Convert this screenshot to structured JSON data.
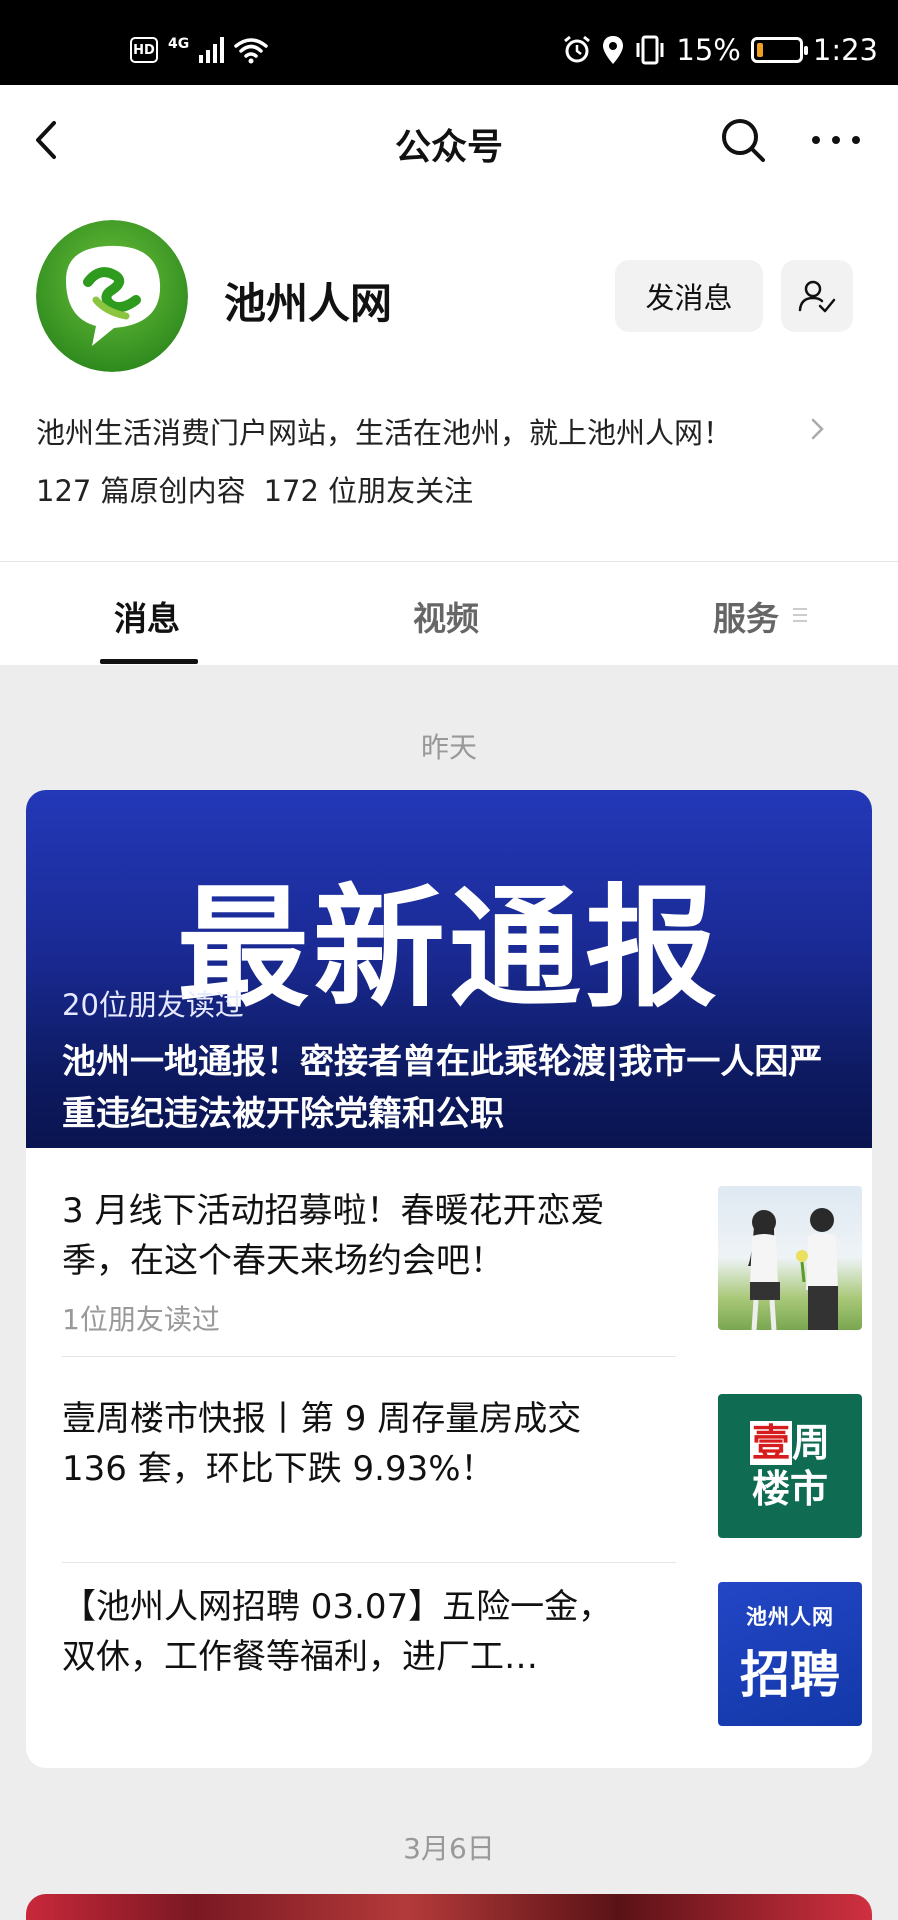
{
  "status_bar": {
    "hd": "HD",
    "network": "4G",
    "battery_percent": "15%",
    "time": "1:23",
    "battery_level": 0.15
  },
  "nav": {
    "title": "公众号",
    "icons": [
      "back-icon",
      "search-icon",
      "more-icon"
    ]
  },
  "account": {
    "name": "池州人网",
    "send_message_label": "发消息",
    "description": "池州生活消费门户网站，生活在池州，就上池州人网！",
    "original_count": "127 篇原创内容",
    "followers": "172 位朋友关注"
  },
  "tabs": [
    {
      "label": "消息",
      "active": true
    },
    {
      "label": "视频",
      "active": false
    },
    {
      "label": "服务",
      "active": false
    }
  ],
  "feed": {
    "date_1": "昨天",
    "hero": {
      "image_text": "最新通报",
      "reads": "20位朋友读过",
      "headline": "池州一地通报！密接者曾在此乘轮渡|我市一人因严重违纪违法被开除党籍和公职"
    },
    "items": [
      {
        "title": "3 月线下活动招募啦！春暖花开恋爱季，在这个春天来场约会吧！",
        "reads": "1位朋友读过",
        "thumb": "couple-photo"
      },
      {
        "title": "壹周楼市快报丨第 9 周存量房成交 136 套，环比下跌 9.93%！",
        "reads": "",
        "thumb_line1_red": "壹",
        "thumb_line1_rest": "周",
        "thumb_line2": "楼市"
      },
      {
        "title": "【池州人网招聘 03.07】五险一金，双休，工作餐等福利，进厂工…",
        "reads": "",
        "thumb_small": "池州人网",
        "thumb_big": "招聘"
      }
    ],
    "date_2": "3月6日"
  }
}
